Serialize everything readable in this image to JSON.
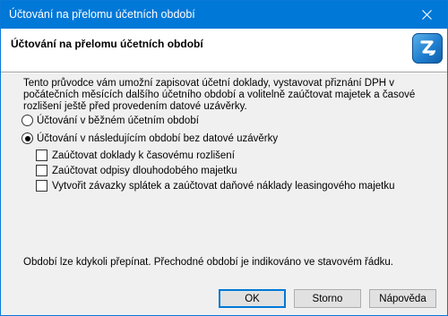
{
  "window": {
    "title": "Účtování na přelomu účetních období"
  },
  "header": {
    "title": "Účtování na přelomu účetních období",
    "logo": "app-logo"
  },
  "description": "Tento průvodce vám umožní zapisovat účetní doklady, vystavovat přiznání DPH v počátečních měsících dalšího účetního období a volitelně zaúčtovat majetek a časové rozlišení ještě před provedením datové uzávěrky.",
  "options": {
    "radio_current": {
      "label": "Účtování v běžném účetním období",
      "checked": false
    },
    "radio_next": {
      "label": "Účtování v následujícím období bez datové uzávěrky",
      "checked": true
    },
    "checkboxes": [
      {
        "label": "Zaúčtovat doklady k časovému rozlišení",
        "checked": false
      },
      {
        "label": "Zaúčtovat odpisy dlouhodobého majetku",
        "checked": false
      },
      {
        "label": "Vytvořit závazky splátek a zaúčtovat daňové náklady leasingového majetku",
        "checked": false
      }
    ]
  },
  "footer_text": "Období lze kdykoli přepínat. Přechodné období je indikováno ve stavovém řádku.",
  "buttons": {
    "ok": "OK",
    "cancel": "Storno",
    "help": "Nápověda"
  },
  "colors": {
    "titlebar": "#0078d7",
    "dialog_bg": "#f0f0f0",
    "header_bg": "#ffffff",
    "logo": "#1f7ecf"
  }
}
